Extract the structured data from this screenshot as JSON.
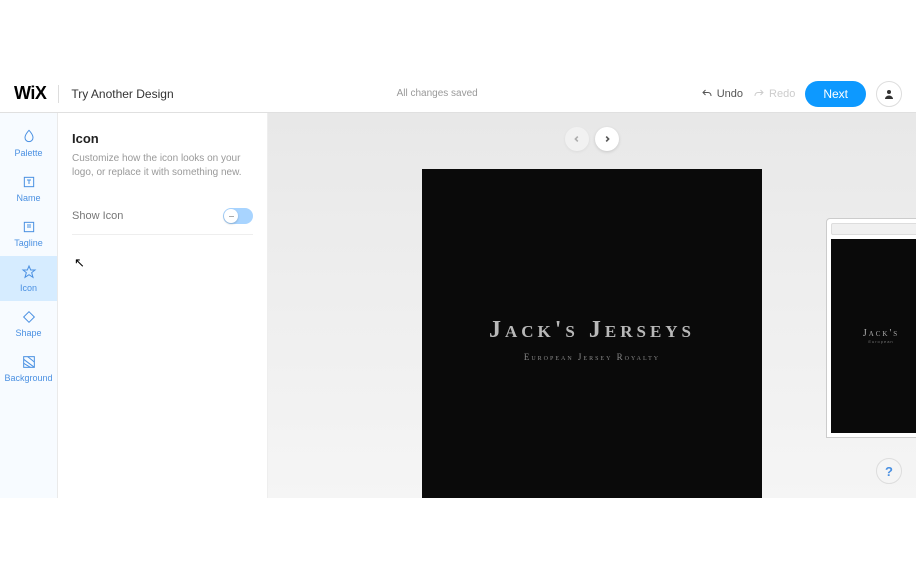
{
  "header": {
    "logo": "WiX",
    "try_another": "Try Another Design",
    "status": "All changes saved",
    "undo": "Undo",
    "redo": "Redo",
    "next": "Next"
  },
  "rail": {
    "items": [
      {
        "label": "Palette"
      },
      {
        "label": "Name"
      },
      {
        "label": "Tagline"
      },
      {
        "label": "Icon"
      },
      {
        "label": "Shape"
      },
      {
        "label": "Background"
      }
    ]
  },
  "panel": {
    "title": "Icon",
    "description": "Customize how the icon looks on your logo, or replace it with something new.",
    "show_icon_label": "Show Icon"
  },
  "preview": {
    "logo_name": "Jack's Jerseys",
    "logo_tagline": "European Jersey Royalty",
    "mini_name": "Jack's",
    "mini_tag": "European"
  },
  "help": "?"
}
